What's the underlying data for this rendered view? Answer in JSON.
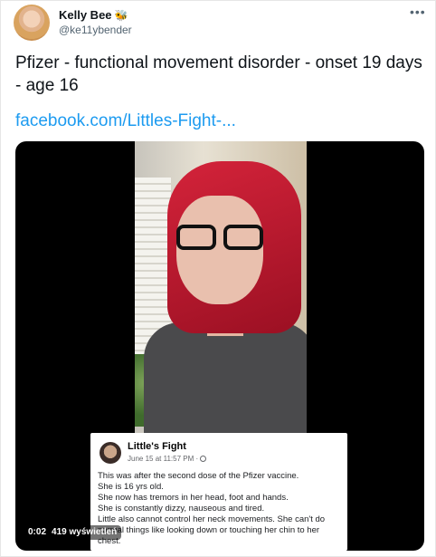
{
  "author": {
    "name": "Kelly Bee",
    "badge_icon": "bee-emoji-icon",
    "handle": "@ke11ybender"
  },
  "more_icon": "more-horizontal-icon",
  "tweet": {
    "text": "Pfizer - functional movement disorder - onset 19 days - age 16",
    "link": "facebook.com/Littles-Fight-..."
  },
  "video": {
    "time": "0:02",
    "views": "419 wyświetleń"
  },
  "embedded_post": {
    "page_name": "Little's Fight",
    "meta": "June 15 at 11:57 PM ·",
    "lines": [
      "This was after the second dose of the Pfizer vaccine.",
      "She is 16 yrs old.",
      "She now has tremors in her head, foot and hands.",
      "She is constantly dizzy, nauseous and tired.",
      "Little also cannot control her neck movements. She can't do",
      "normal things like looking down or touching her chin to her",
      "chest."
    ]
  },
  "colors": {
    "link": "#1d9bf0",
    "secondary_text": "#536471",
    "hair": "#c41d34"
  }
}
